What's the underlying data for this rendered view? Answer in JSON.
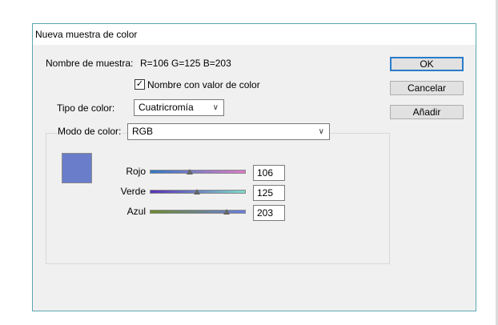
{
  "window": {
    "title": "Nueva muestra de color"
  },
  "swatch_name": {
    "label": "Nombre de muestra:",
    "value": "R=106 G=125 B=203"
  },
  "name_with_value": {
    "checked": true,
    "label": "Nombre con valor de color"
  },
  "color_type": {
    "label": "Tipo de color:",
    "value": "Cuatricromía"
  },
  "color_mode": {
    "label": "Modo de color:",
    "value": "RGB"
  },
  "swatch_color": "#6a7dcb",
  "sliders": [
    {
      "label": "Rojo",
      "value": "106",
      "fraction": 0.416,
      "gradient": [
        "#2d79c4",
        "#e07ac8"
      ]
    },
    {
      "label": "Verde",
      "value": "125",
      "fraction": 0.49,
      "gradient": [
        "#5b2fb8",
        "#7ddccb"
      ]
    },
    {
      "label": "Azul",
      "value": "203",
      "fraction": 0.796,
      "gradient": [
        "#6b8a2a",
        "#6a7de0"
      ]
    }
  ],
  "buttons": {
    "ok": "OK",
    "cancel": "Cancelar",
    "add": "Añadir"
  },
  "icons": {
    "check": "✓",
    "dropdown": "chevron-down-icon"
  }
}
